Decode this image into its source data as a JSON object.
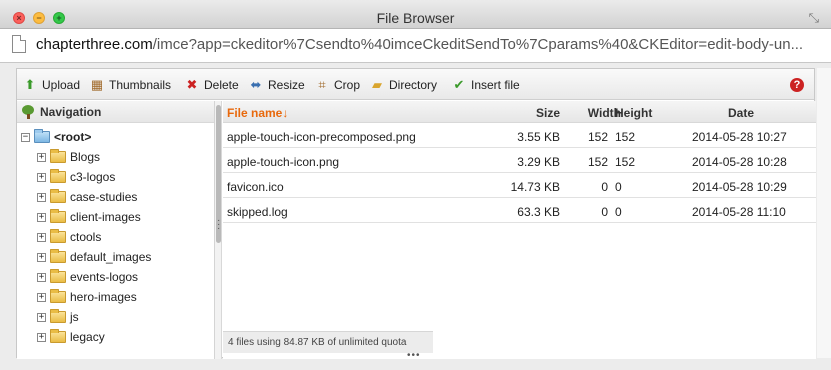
{
  "window": {
    "title": "File Browser",
    "close_glyph": "×",
    "min_glyph": "−",
    "max_glyph": "+",
    "resize_glyph": "⤡"
  },
  "url": {
    "host": "chapterthree.com",
    "path": "/imce?app=ckeditor%7Csendto%40imceCkeditSendTo%7Cparams%40&CKEditor=edit-body-un..."
  },
  "toolbar": {
    "items": [
      {
        "label": "Upload",
        "icon": "upload-icon",
        "glyph": "⬆",
        "color": "#3a9a2a"
      },
      {
        "label": "Thumbnails",
        "icon": "thumbnails-icon",
        "glyph": "▦",
        "color": "#a0692a"
      },
      {
        "label": "Delete",
        "icon": "delete-icon",
        "glyph": "✖",
        "color": "#cc2222"
      },
      {
        "label": "Resize",
        "icon": "resize-icon",
        "glyph": "⬌",
        "color": "#3a6fb0"
      },
      {
        "label": "Crop",
        "icon": "crop-icon",
        "glyph": "⌗",
        "color": "#a0692a"
      },
      {
        "label": "Directory",
        "icon": "directory-icon",
        "glyph": "▰",
        "color": "#d9a52e"
      },
      {
        "label": "Insert file",
        "icon": "insert-file-icon",
        "glyph": "✔",
        "color": "#3a9a2a"
      }
    ],
    "help_glyph": "?"
  },
  "navigation": {
    "title": "Navigation",
    "root": "<root>",
    "folders": [
      "Blogs",
      "c3-logos",
      "case-studies",
      "client-images",
      "ctools",
      "default_images",
      "events-logos",
      "hero-images",
      "js",
      "legacy"
    ]
  },
  "files": {
    "columns": {
      "name": "File name↓",
      "size": "Size",
      "width": "Width",
      "height": "Height",
      "date": "Date"
    },
    "rows": [
      {
        "name": "apple-touch-icon-precomposed.png",
        "size": "3.55 KB",
        "width": "152",
        "height": "152",
        "date": "2014-05-28 10:27"
      },
      {
        "name": "apple-touch-icon.png",
        "size": "3.29 KB",
        "width": "152",
        "height": "152",
        "date": "2014-05-28 10:28"
      },
      {
        "name": "favicon.ico",
        "size": "14.73 KB",
        "width": "0",
        "height": "0",
        "date": "2014-05-28 10:29"
      },
      {
        "name": "skipped.log",
        "size": "63.3 KB",
        "width": "0",
        "height": "0",
        "date": "2014-05-28 11:10"
      }
    ],
    "status": "4 files using 84.87 KB of unlimited quota"
  },
  "colors": {
    "sort_column": "#e8690d",
    "help": "#cc2222"
  }
}
